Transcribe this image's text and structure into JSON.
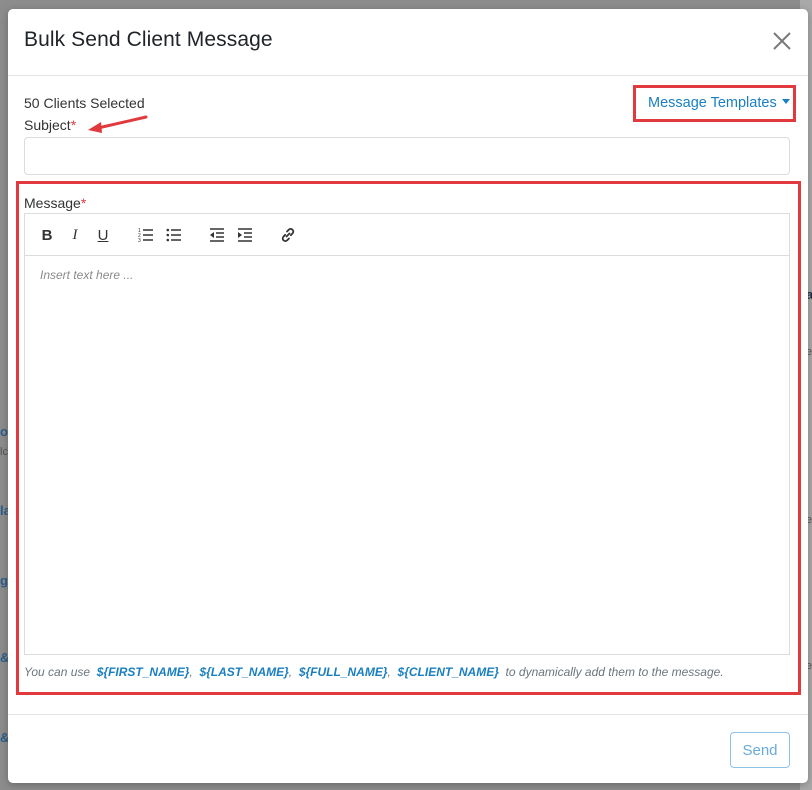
{
  "modal": {
    "title": "Bulk Send Client Message",
    "selected_count": "50 Clients Selected",
    "templates_label": "Message Templates",
    "subject_label": "Subject",
    "message_label": "Message",
    "required_mark": "*",
    "subject_value": "",
    "editor_placeholder": "Insert text here ...",
    "hint_prefix": "You can use",
    "variables": [
      "${FIRST_NAME}",
      "${LAST_NAME}",
      "${FULL_NAME}",
      "${CLIENT_NAME}"
    ],
    "hint_suffix": "to dynamically add them to the message.",
    "send_label": "Send"
  },
  "toolbar": {
    "bold": "B",
    "italic": "I",
    "underline": "U"
  },
  "background": {
    "frags": [
      "a",
      "e",
      "oi",
      "lc",
      "la",
      "e",
      "g",
      "&",
      "e",
      "&"
    ]
  },
  "icons": [
    "close-icon",
    "chevron-down-icon",
    "ordered-list-icon",
    "bullet-list-icon",
    "outdent-icon",
    "indent-icon",
    "link-icon",
    "annotation-arrow-icon"
  ],
  "colors": {
    "accent": "#1a7fc1",
    "highlight": "#e0393e",
    "required": "#e0393e"
  }
}
